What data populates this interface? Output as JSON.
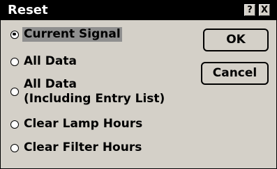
{
  "dialog": {
    "title": "Reset",
    "help_icon": "?",
    "close_icon": "X"
  },
  "options": [
    {
      "label": "Current Signal",
      "checked": true
    },
    {
      "label": "All Data",
      "checked": false
    },
    {
      "label_line1": "All Data",
      "label_line2": "(Including Entry List)",
      "checked": false
    },
    {
      "label": "Clear Lamp Hours",
      "checked": false
    },
    {
      "label": "Clear Filter Hours",
      "checked": false
    }
  ],
  "buttons": {
    "ok": "OK",
    "cancel": "Cancel"
  }
}
